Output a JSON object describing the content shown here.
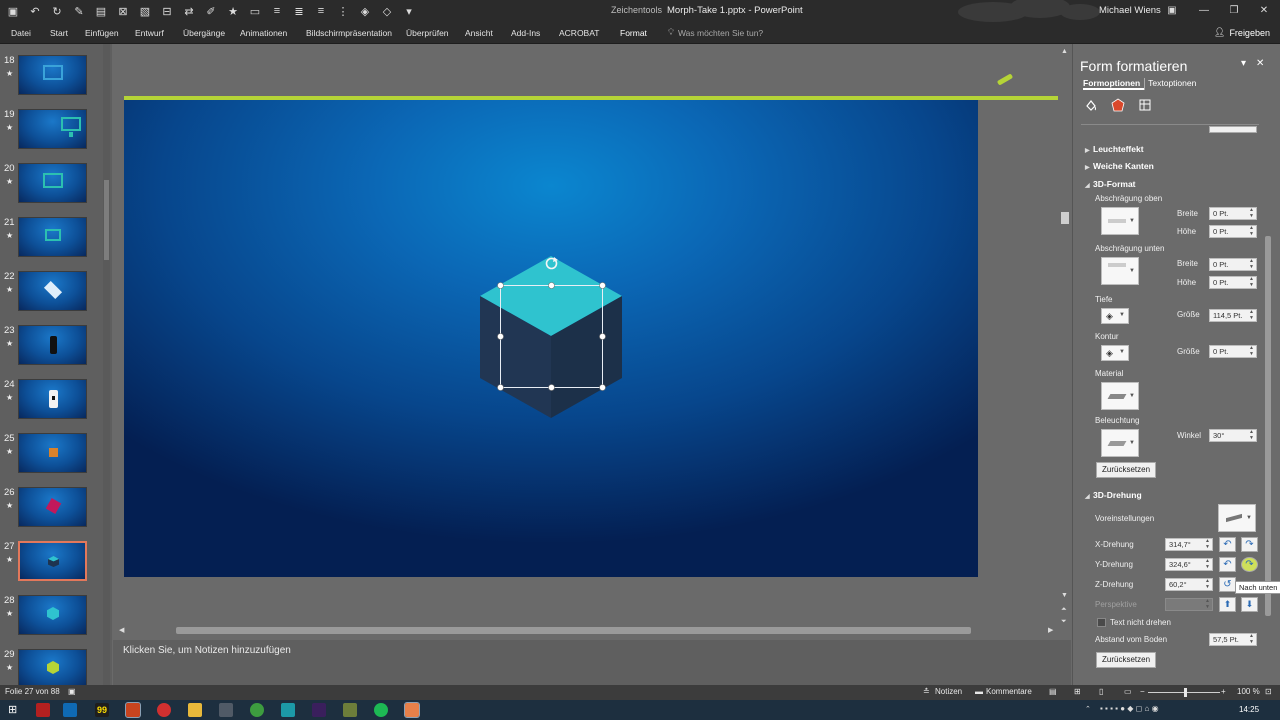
{
  "titlebar": {
    "context_tools": "Zeichentools",
    "title": "Morph-Take 1.pptx - PowerPoint",
    "user": "Michael Wiens"
  },
  "ribbon": {
    "tabs": [
      "Datei",
      "Start",
      "Einfügen",
      "Entwurf",
      "Übergänge",
      "Animationen",
      "Bildschirmpräsentation",
      "Überprüfen",
      "Ansicht",
      "Add-Ins",
      "ACROBAT",
      "Format"
    ],
    "active_tab": "Format",
    "tell_me": "Was möchten Sie tun?",
    "share": "Freigeben"
  },
  "thumbnails": [
    {
      "number": "18",
      "star": "★",
      "content": "frame"
    },
    {
      "number": "19",
      "star": "★",
      "content": "monitor"
    },
    {
      "number": "20",
      "star": "★",
      "content": "frame-green"
    },
    {
      "number": "21",
      "star": "★",
      "content": "frame-green-small"
    },
    {
      "number": "22",
      "star": "★",
      "content": "diamond-white"
    },
    {
      "number": "23",
      "star": "★",
      "content": "phone-black"
    },
    {
      "number": "24",
      "star": "★",
      "content": "phone-white"
    },
    {
      "number": "25",
      "star": "★",
      "content": "square-orange"
    },
    {
      "number": "26",
      "star": "★",
      "content": "cube-magenta"
    },
    {
      "number": "27",
      "star": "★",
      "content": "cube-teal",
      "selected": true
    },
    {
      "number": "28",
      "star": "★",
      "content": "cube-cyan"
    },
    {
      "number": "29",
      "star": "★",
      "content": "cube-lime"
    }
  ],
  "notes": {
    "placeholder": "Klicken Sie, um Notizen hinzuzufügen"
  },
  "pane": {
    "title": "Form formatieren",
    "tabs": [
      "Formoptionen",
      "Textoptionen"
    ],
    "sections": {
      "leuchteffekt": "Leuchteffekt",
      "weiche_kanten": "Weiche Kanten",
      "format3d": "3D-Format",
      "drehung3d": "3D-Drehung"
    },
    "format3d": {
      "bevel_top": "Abschrägung oben",
      "bevel_bottom": "Abschrägung unten",
      "depth": "Tiefe",
      "contour": "Kontur",
      "material": "Material",
      "lighting": "Beleuchtung",
      "width_label": "Breite",
      "height_label": "Höhe",
      "size_label": "Größe",
      "angle_label": "Winkel",
      "bevel_top_width": "0 Pt.",
      "bevel_top_height": "0 Pt.",
      "bevel_bottom_width": "0 Pt.",
      "bevel_bottom_height": "0 Pt.",
      "depth_size": "114,5 Pt.",
      "contour_size": "0 Pt.",
      "lighting_angle": "30°",
      "reset": "Zurücksetzen"
    },
    "rotation3d": {
      "presets": "Voreinstellungen",
      "x_label": "X-Drehung",
      "y_label": "Y-Drehung",
      "z_label": "Z-Drehung",
      "perspective_label": "Perspektive",
      "x_value": "314,7°",
      "y_value": "324,6°",
      "z_value": "60,2°",
      "perspective_value": "",
      "keep_text_flat": "Text nicht drehen",
      "distance_label": "Abstand vom Boden",
      "distance_value": "57,5 Pt.",
      "reset": "Zurücksetzen"
    },
    "tooltip": "Nach unten"
  },
  "statusbar": {
    "slide_info": "Folie 27 von 88",
    "notes": "Notizen",
    "comments": "Kommentare",
    "zoom": "100 %"
  },
  "taskbar": {
    "clock": "14:25"
  },
  "colors": {
    "accent_green": "#b5d437",
    "selected_thumb_border": "#e3785b",
    "slide_top": "#0b86cf",
    "slide_bottom": "#041f52",
    "cube_top": "#2fc3cf",
    "cube_side": "#1e3450"
  }
}
